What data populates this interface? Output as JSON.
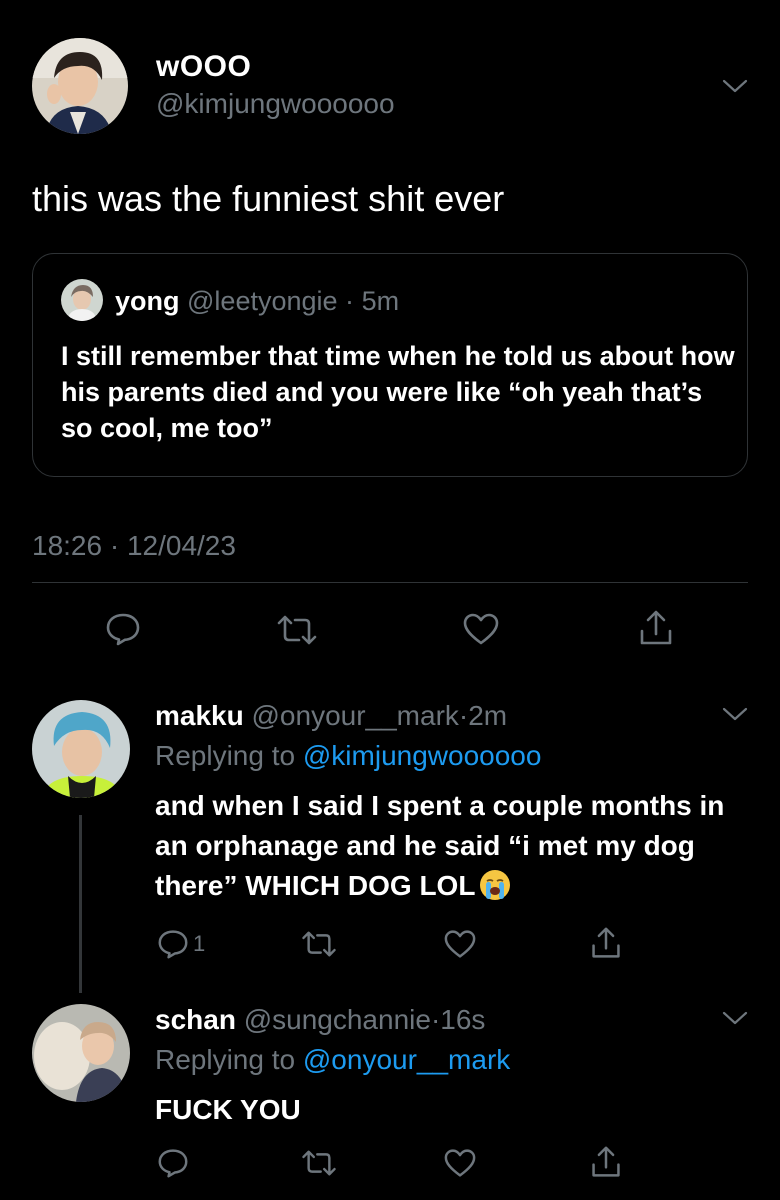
{
  "main_tweet": {
    "display_name": "wOOO",
    "handle": "@kimjungwoooooo",
    "text": "this was the funniest shit ever",
    "timestamp": "18:26 · 12/04/23",
    "quote": {
      "display_name": "yong",
      "handle": "@leetyongie",
      "separator": "·",
      "time": "5m",
      "text": "I still remember that time when he told us about how his parents died and you were like “oh yeah that’s so cool, me too”"
    }
  },
  "replies": [
    {
      "display_name": "makku",
      "handle": "@onyour__mark",
      "separator": "·",
      "time": "2m",
      "replying_prefix": "Replying to",
      "replying_to": "@kimjungwoooooo",
      "text": "and when I said I spent a couple months in an orphanage and he said “i met my dog there” WHICH DOG LOL",
      "reply_count": "1"
    },
    {
      "display_name": "schan",
      "handle": "@sungchannie",
      "separator": "·",
      "time": "16s",
      "replying_prefix": "Replying to",
      "replying_to": "@onyour__mark",
      "text": "FUCK YOU"
    }
  ],
  "icons": [
    "comment-icon",
    "retweet-icon",
    "like-icon",
    "share-icon",
    "chevron-down-icon",
    "crying-face-emoji"
  ],
  "colors": {
    "background": "#000000",
    "muted": "#6e767d",
    "link": "#1d9bf0",
    "border": "#2f3336"
  }
}
